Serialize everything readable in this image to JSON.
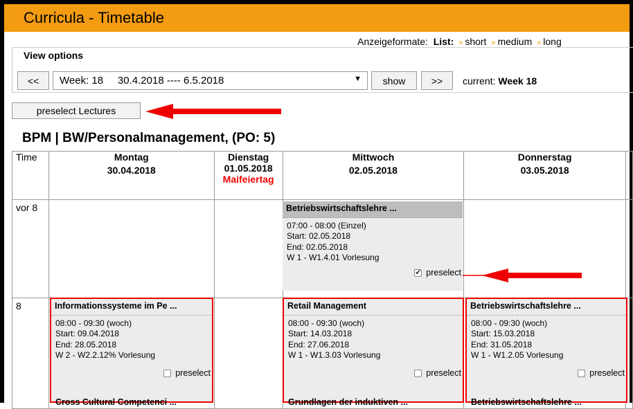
{
  "window": {
    "title": "Curricula - Timetable"
  },
  "formats": {
    "label": "Anzeigeformate:",
    "list_label": "List:",
    "options": [
      "short",
      "medium",
      "long"
    ],
    "sep": "»"
  },
  "view_options": {
    "legend": "View options",
    "prev_label": "<<",
    "next_label": ">>",
    "show_label": "show",
    "week_select": "Week: 18     30.4.2018 ---- 6.5.2018",
    "current_label": "current:",
    "current_value": "Week 18"
  },
  "preselect_button": "preselect Lectures",
  "program_heading": "BPM | BW/Personalmanagement, (PO: 5)",
  "table": {
    "time_header": "Time",
    "days": [
      {
        "name": "Montag",
        "date": "30.04.2018",
        "holiday": ""
      },
      {
        "name": "Dienstag",
        "date": "01.05.2018",
        "holiday": "Maifeiertag"
      },
      {
        "name": "Mittwoch",
        "date": "02.05.2018",
        "holiday": ""
      },
      {
        "name": "Donnerstag",
        "date": "03.05.2018",
        "holiday": ""
      }
    ],
    "rows": [
      "vor 8",
      "8"
    ]
  },
  "events": [
    {
      "title": "Betriebswirtschaftslehre ...",
      "time": "07:00 - 08:00 (Einzel)",
      "start": "Start:  02.05.2018",
      "end": "End:  02.05.2018",
      "room": "W 1 - W1.4.01  Vorlesung",
      "preselect": "preselect",
      "checked": true
    },
    {
      "title": "Informationssysteme im Pe ...",
      "time": "08:00 - 09:30 (woch)",
      "start": "Start:  09.04.2018",
      "end": "End:  28.05.2018",
      "room": "W 2 - W2.2.12%  Vorlesung",
      "preselect": "preselect",
      "checked": false
    },
    {
      "title": "Retail Management",
      "time": "08:00 - 09:30 (woch)",
      "start": "Start:  14.03.2018",
      "end": "End:  27.06.2018",
      "room": "W 1 - W1.3.03  Vorlesung",
      "preselect": "preselect",
      "checked": false
    },
    {
      "title": "Betriebswirtschaftslehre ...",
      "time": "08:00 - 09:30 (woch)",
      "start": "Start:  15.03.2018",
      "end": "End:  31.05.2018",
      "room": "W 1 - W1.2.05  Vorlesung",
      "preselect": "preselect",
      "checked": false
    }
  ],
  "next_events": [
    "Cross Cultural Competenci ...",
    "Grundlagen der induktiven ...",
    "Betriebswirtschaftslehre ..."
  ],
  "colors": {
    "title_bar": "#f39c12",
    "highlight_border": "#ee0000",
    "holiday": "#ee0000",
    "annotation_arrow": "#ee0000"
  }
}
